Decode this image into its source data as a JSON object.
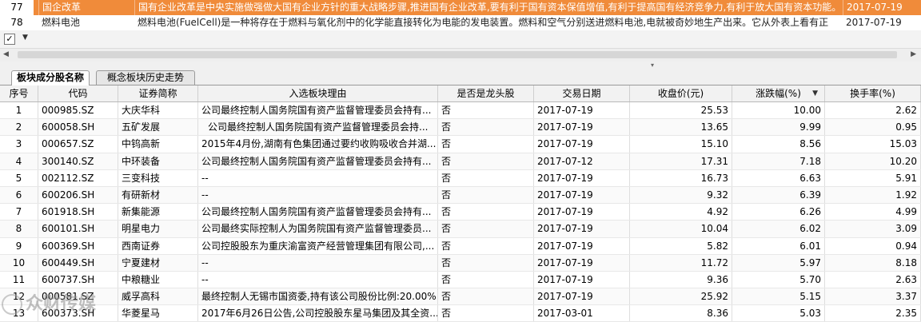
{
  "concept_list": [
    {
      "no": "77",
      "name": "国企改革",
      "desc": "国有企业改革是中央实施做强做大国有企业方针的重大战略步骤,推进国有企业改革,要有利于国有资本保值增值,有利于提高国有经济竞争力,有利于放大国有资本功能。",
      "date": "2017-07-19",
      "selected": true
    },
    {
      "no": "78",
      "name": "燃料电池",
      "desc": "燃料电池(FuelCell)是一种将存在于燃料与氧化剂中的化学能直接转化为电能的发电装置。燃料和空气分别送进燃料电池,电就被奇妙地生产出来。它从外表上看有正",
      "date": "2017-07-19",
      "selected": false
    }
  ],
  "toolbar": {
    "check": "✓",
    "dropdown": "▼"
  },
  "tabs": [
    {
      "label": "板块成分股名称",
      "active": true
    },
    {
      "label": "概念板块历史走势",
      "active": false
    }
  ],
  "grid": {
    "headers": [
      "序号",
      "代码",
      "证券简称",
      "入选板块理由",
      "是否是龙头股",
      "交易日期",
      "收盘价(元)",
      "涨跌幅(%)",
      "换手率(%)"
    ],
    "sorted_column": "涨跌幅(%)",
    "rows": [
      [
        "1",
        "000985.SZ",
        "大庆华科",
        "公司最终控制人国务院国有资产监督管理委员会持有...",
        "否",
        "2017-07-19",
        "25.53",
        "10.00",
        "2.62"
      ],
      [
        "2",
        "600058.SH",
        "五矿发展",
        "公司最终控制人国务院国有资产监督管理委员会持...",
        "否",
        "2017-07-19",
        "13.65",
        "9.99",
        "0.95"
      ],
      [
        "3",
        "000657.SZ",
        "中钨高新",
        "2015年4月份,湖南有色集团通过要约收购吸收合并湖...",
        "否",
        "2017-07-19",
        "15.10",
        "8.56",
        "15.03"
      ],
      [
        "4",
        "300140.SZ",
        "中环装备",
        "公司最终控制人国务院国有资产监督管理委员会持有...",
        "否",
        "2017-07-12",
        "17.31",
        "7.18",
        "10.20"
      ],
      [
        "5",
        "002112.SZ",
        "三变科技",
        "--",
        "否",
        "2017-07-19",
        "16.73",
        "6.63",
        "5.91"
      ],
      [
        "6",
        "600206.SH",
        "有研新材",
        "--",
        "否",
        "2017-07-19",
        "9.32",
        "6.39",
        "1.92"
      ],
      [
        "7",
        "601918.SH",
        "新集能源",
        "公司最终控制人国务院国有资产监督管理委员会持有...",
        "否",
        "2017-07-19",
        "4.92",
        "6.26",
        "4.99"
      ],
      [
        "8",
        "600101.SH",
        "明星电力",
        "公司最终实际控制人为国务院国有资产监督管理委员...",
        "否",
        "2017-07-19",
        "10.04",
        "6.02",
        "3.09"
      ],
      [
        "9",
        "600369.SH",
        "西南证券",
        "公司控股股东为重庆渝富资产经营管理集团有限公司,...",
        "否",
        "2017-07-19",
        "5.82",
        "6.01",
        "0.94"
      ],
      [
        "10",
        "600449.SH",
        "宁夏建材",
        "--",
        "否",
        "2017-07-19",
        "11.72",
        "5.97",
        "8.18"
      ],
      [
        "11",
        "600737.SH",
        "中粮糖业",
        "--",
        "否",
        "2017-07-19",
        "9.36",
        "5.70",
        "2.63"
      ],
      [
        "12",
        "000581.SZ",
        "威孚高科",
        "最终控制人无锡市国资委,持有该公司股份比例:20.00%",
        "否",
        "2017-07-19",
        "25.92",
        "5.15",
        "3.37"
      ],
      [
        "13",
        "600373.SH",
        "华菱星马",
        "2017年6月26日公告,公司控股股东星马集团及其全资...",
        "否",
        "2017-03-01",
        "8.36",
        "5.03",
        "2.35"
      ]
    ]
  },
  "watermark": "众财传媒"
}
